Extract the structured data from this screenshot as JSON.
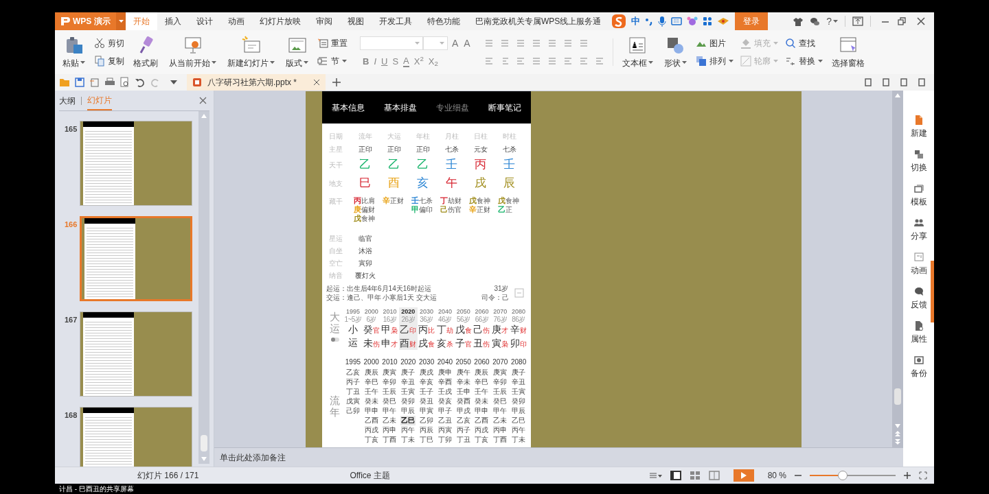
{
  "app": {
    "name": "WPS 演示"
  },
  "menu_tabs": [
    {
      "label": "开始",
      "selected": true
    },
    {
      "label": "插入",
      "selected": false
    },
    {
      "label": "设计",
      "selected": false
    },
    {
      "label": "动画",
      "selected": false
    },
    {
      "label": "幻灯片放映",
      "selected": false
    },
    {
      "label": "审阅",
      "selected": false
    },
    {
      "label": "视图",
      "selected": false
    },
    {
      "label": "开发工具",
      "selected": false
    },
    {
      "label": "特色功能",
      "selected": false
    },
    {
      "label": "巴南党政机关专属WPS线上服务通",
      "selected": false
    }
  ],
  "ime_toolbar": {
    "mode": "中"
  },
  "login_button": "登录",
  "help": "?",
  "ribbon": [
    {
      "kind": "large",
      "label": "粘贴",
      "dropdown": true
    },
    {
      "kind": "stack",
      "items": [
        {
          "label": "剪切",
          "dropdown": false,
          "disabled": false
        },
        {
          "label": "复制",
          "dropdown": false,
          "disabled": false
        }
      ]
    },
    {
      "kind": "large",
      "label": "格式刷",
      "dropdown": false
    },
    {
      "kind": "large",
      "label": "从当前开始",
      "dropdown": true
    },
    {
      "kind": "large",
      "label": "新建幻灯片",
      "dropdown": true
    },
    {
      "kind": "large",
      "label": "版式",
      "dropdown": true
    },
    {
      "kind": "stack",
      "items": [
        {
          "label": "重置",
          "dropdown": false,
          "disabled": false
        },
        {
          "label": "节",
          "dropdown": true,
          "disabled": false
        }
      ]
    },
    {
      "kind": "font",
      "size_buttons": [
        "A",
        "A"
      ],
      "format_buttons": [
        "B",
        "I",
        "U",
        "S",
        "A",
        "X$^{2}$",
        "X$_{2}$"
      ]
    },
    {
      "kind": "paragraph"
    },
    {
      "kind": "large",
      "label": "文本框",
      "dropdown": true
    },
    {
      "kind": "large",
      "label": "形状",
      "dropdown": true
    },
    {
      "kind": "stack",
      "items": [
        {
          "label": "图片",
          "dropdown": false,
          "disabled": false
        },
        {
          "label": "排列",
          "dropdown": true,
          "disabled": false
        }
      ]
    },
    {
      "kind": "stack",
      "items": [
        {
          "label": "填充",
          "dropdown": true,
          "disabled": true
        },
        {
          "label": "轮廓",
          "dropdown": true,
          "disabled": true
        }
      ]
    },
    {
      "kind": "stack",
      "items": [
        {
          "label": "查找",
          "dropdown": false,
          "disabled": false
        },
        {
          "label": "替换",
          "dropdown": true,
          "disabled": false
        }
      ]
    },
    {
      "kind": "large",
      "label": "选择窗格",
      "dropdown": false
    }
  ],
  "document_tab": {
    "title": "八字研习社第六期.pptx *"
  },
  "sidebar": {
    "tabs": [
      {
        "label": "大纲",
        "selected": false
      },
      {
        "label": "幻灯片",
        "selected": true
      }
    ],
    "slides": [
      {
        "number": "165",
        "selected": false
      },
      {
        "number": "166",
        "selected": true
      },
      {
        "number": "167",
        "selected": false
      },
      {
        "number": "168",
        "selected": false
      }
    ]
  },
  "slide": {
    "tabs": [
      {
        "label": "基本信息",
        "dimmed": false
      },
      {
        "label": "基本排盘",
        "dimmed": false
      },
      {
        "label": "专业细盘",
        "dimmed": true
      },
      {
        "label": "断事笔记",
        "dimmed": false
      }
    ],
    "columns": [
      "日期",
      "流年",
      "大运",
      "年柱",
      "月柱",
      "日柱",
      "时柱"
    ],
    "main_stars": {
      "label": "主星",
      "values": [
        "正印",
        "正印",
        "正印",
        "七杀",
        "元女",
        "七杀"
      ]
    },
    "stems": {
      "label": "天干",
      "values": [
        {
          "text": "乙",
          "color": "#16b36a"
        },
        {
          "text": "乙",
          "color": "#16b36a"
        },
        {
          "text": "乙",
          "color": "#16b36a"
        },
        {
          "text": "壬",
          "color": "#2c86d4"
        },
        {
          "text": "丙",
          "color": "#d6222e"
        },
        {
          "text": "壬",
          "color": "#2c86d4"
        }
      ]
    },
    "branches": {
      "label": "地支",
      "values": [
        {
          "text": "巳",
          "color": "#d6222e"
        },
        {
          "text": "酉",
          "color": "#e8a317"
        },
        {
          "text": "亥",
          "color": "#2c86d4"
        },
        {
          "text": "午",
          "color": "#d6222e"
        },
        {
          "text": "戌",
          "color": "#a08d1c"
        },
        {
          "text": "辰",
          "color": "#a08d1c"
        }
      ]
    },
    "hidden_stems": {
      "label": "藏干",
      "columns": [
        [
          {
            "stem": "丙",
            "color": "#d6222e",
            "god": "比肩"
          },
          {
            "stem": "庚",
            "color": "#e8a317",
            "god": "偏财"
          },
          {
            "stem": "戊",
            "color": "#a08d1c",
            "god": "食神"
          }
        ],
        [
          {
            "stem": "辛",
            "color": "#e8a317",
            "god": "正财"
          }
        ],
        [
          {
            "stem": "壬",
            "color": "#2c86d4",
            "god": "七杀"
          },
          {
            "stem": "甲",
            "color": "#16b36a",
            "god": "偏印"
          }
        ],
        [
          {
            "stem": "丁",
            "color": "#d6222e",
            "god": "劫财"
          },
          {
            "stem": "己",
            "color": "#a08d1c",
            "god": "伤官"
          }
        ],
        [
          {
            "stem": "戊",
            "color": "#a08d1c",
            "god": "食神"
          },
          {
            "stem": "辛",
            "color": "#e8a317",
            "god": "正财"
          }
        ],
        [
          {
            "stem": "戊",
            "color": "#a08d1c",
            "god": "食神"
          },
          {
            "stem": "乙",
            "color": "#16b36a",
            "god": "正"
          }
        ]
      ]
    },
    "info_rows": [
      {
        "label": "星运",
        "value": "临官"
      },
      {
        "label": "自坐",
        "value": "沐浴"
      },
      {
        "label": "空亡",
        "value": "寅卯"
      },
      {
        "label": "纳音",
        "value": "覆灯火"
      }
    ],
    "luck_lines": [
      {
        "text": "起运：出生后4年6月14天16时起运",
        "side": "31岁"
      },
      {
        "text": "交运：逢己、甲年 小寒后1天 交大运",
        "side": "司令：己"
      }
    ],
    "dayun": {
      "label": "大运",
      "columns": [
        {
          "year": "1995",
          "age": "1~5岁",
          "stem": "小",
          "branch": "运",
          "selected": false
        },
        {
          "year": "2000",
          "age": "6岁",
          "stem": "癸",
          "stem_god": "官",
          "branch": "未",
          "branch_god": "伤",
          "selected": false
        },
        {
          "year": "2010",
          "age": "16岁",
          "stem": "甲",
          "stem_god": "枭",
          "branch": "申",
          "branch_god": "才",
          "selected": false
        },
        {
          "year": "2020",
          "age": "26岁",
          "stem": "乙",
          "stem_god": "印",
          "branch": "酉",
          "branch_god": "财",
          "selected": true
        },
        {
          "year": "2030",
          "age": "36岁",
          "stem": "丙",
          "stem_god": "比",
          "branch": "戌",
          "branch_god": "食",
          "selected": false
        },
        {
          "year": "2040",
          "age": "46岁",
          "stem": "丁",
          "stem_god": "劫",
          "branch": "亥",
          "branch_god": "杀",
          "selected": false
        },
        {
          "year": "2050",
          "age": "56岁",
          "stem": "戊",
          "stem_god": "食",
          "branch": "子",
          "branch_god": "官",
          "selected": false
        },
        {
          "year": "2060",
          "age": "66岁",
          "stem": "己",
          "stem_god": "伤",
          "branch": "丑",
          "branch_god": "伤",
          "selected": false
        },
        {
          "year": "2070",
          "age": "76岁",
          "stem": "庚",
          "stem_god": "才",
          "branch": "寅",
          "branch_god": "枭",
          "selected": false
        },
        {
          "year": "2080",
          "age": "86岁",
          "stem": "辛",
          "stem_god": "财",
          "branch": "卯",
          "branch_god": "印",
          "selected": false
        }
      ]
    },
    "liunian": {
      "label": "流年",
      "columns": [
        {
          "year": "1995",
          "items": [
            {
              "text": "乙亥",
              "selected": false
            },
            {
              "text": "丙子",
              "selected": false
            },
            {
              "text": "丁丑",
              "selected": false
            },
            {
              "text": "戊寅",
              "selected": false
            },
            {
              "text": "己卯",
              "selected": false
            }
          ]
        },
        {
          "year": "2000",
          "items": [
            {
              "text": "庚辰",
              "selected": false
            },
            {
              "text": "辛巳",
              "selected": false
            },
            {
              "text": "壬午",
              "selected": false
            },
            {
              "text": "癸未",
              "selected": false
            },
            {
              "text": "甲申",
              "selected": false
            },
            {
              "text": "乙酉",
              "selected": false
            },
            {
              "text": "丙戌",
              "selected": false
            },
            {
              "text": "丁亥",
              "selected": false
            }
          ]
        },
        {
          "year": "2010",
          "items": [
            {
              "text": "庚寅",
              "selected": false
            },
            {
              "text": "辛卯",
              "selected": false
            },
            {
              "text": "壬辰",
              "selected": false
            },
            {
              "text": "癸巳",
              "selected": false
            },
            {
              "text": "甲午",
              "selected": false
            },
            {
              "text": "乙未",
              "selected": false
            },
            {
              "text": "丙申",
              "selected": false
            },
            {
              "text": "丁酉",
              "selected": false
            }
          ]
        },
        {
          "year": "2020",
          "items": [
            {
              "text": "庚子",
              "selected": false
            },
            {
              "text": "辛丑",
              "selected": false
            },
            {
              "text": "壬寅",
              "selected": false
            },
            {
              "text": "癸卯",
              "selected": false
            },
            {
              "text": "甲辰",
              "selected": false
            },
            {
              "text": "乙巳",
              "selected": true
            },
            {
              "text": "丙午",
              "selected": false
            },
            {
              "text": "丁未",
              "selected": false
            }
          ]
        },
        {
          "year": "2030",
          "items": [
            {
              "text": "庚戌",
              "selected": false
            },
            {
              "text": "辛亥",
              "selected": false
            },
            {
              "text": "壬子",
              "selected": false
            },
            {
              "text": "癸丑",
              "selected": false
            },
            {
              "text": "甲寅",
              "selected": false
            },
            {
              "text": "乙卯",
              "selected": false
            },
            {
              "text": "丙辰",
              "selected": false
            },
            {
              "text": "丁巳",
              "selected": false
            }
          ]
        },
        {
          "year": "2040",
          "items": [
            {
              "text": "庚申",
              "selected": false
            },
            {
              "text": "辛酉",
              "selected": false
            },
            {
              "text": "壬戌",
              "selected": false
            },
            {
              "text": "癸亥",
              "selected": false
            },
            {
              "text": "甲子",
              "selected": false
            },
            {
              "text": "乙丑",
              "selected": false
            },
            {
              "text": "丙寅",
              "selected": false
            },
            {
              "text": "丁卯",
              "selected": false
            }
          ]
        },
        {
          "year": "2050",
          "items": [
            {
              "text": "庚午",
              "selected": false
            },
            {
              "text": "辛未",
              "selected": false
            },
            {
              "text": "壬申",
              "selected": false
            },
            {
              "text": "癸酉",
              "selected": false
            },
            {
              "text": "甲戌",
              "selected": false
            },
            {
              "text": "乙亥",
              "selected": false
            },
            {
              "text": "丙子",
              "selected": false
            },
            {
              "text": "丁丑",
              "selected": false
            }
          ]
        },
        {
          "year": "2060",
          "items": [
            {
              "text": "庚辰",
              "selected": false
            },
            {
              "text": "辛巳",
              "selected": false
            },
            {
              "text": "壬午",
              "selected": false
            },
            {
              "text": "癸未",
              "selected": false
            },
            {
              "text": "甲申",
              "selected": false
            },
            {
              "text": "乙酉",
              "selected": false
            },
            {
              "text": "丙戌",
              "selected": false
            },
            {
              "text": "丁亥",
              "selected": false
            }
          ]
        },
        {
          "year": "2070",
          "items": [
            {
              "text": "庚寅",
              "selected": false
            },
            {
              "text": "辛卯",
              "selected": false
            },
            {
              "text": "壬辰",
              "selected": false
            },
            {
              "text": "癸巳",
              "selected": false
            },
            {
              "text": "甲午",
              "selected": false
            },
            {
              "text": "乙未",
              "selected": false
            },
            {
              "text": "丙申",
              "selected": false
            },
            {
              "text": "丁酉",
              "selected": false
            }
          ]
        },
        {
          "year": "2080",
          "items": [
            {
              "text": "庚子",
              "selected": false
            },
            {
              "text": "辛丑",
              "selected": false
            },
            {
              "text": "壬寅",
              "selected": false
            },
            {
              "text": "癸卯",
              "selected": false
            },
            {
              "text": "甲辰",
              "selected": false
            },
            {
              "text": "乙巳",
              "selected": false
            },
            {
              "text": "丙午",
              "selected": false
            },
            {
              "text": "丁未",
              "selected": false
            }
          ]
        }
      ]
    }
  },
  "notes_placeholder": "单击此处添加备注",
  "right_panel": [
    "新建",
    "切换",
    "模板",
    "分享",
    "动画",
    "反馈",
    "属性",
    "备份"
  ],
  "status_bar": {
    "slide_counter": "幻灯片 166 / 171",
    "theme": "Office 主题",
    "views": [
      {
        "selected": true
      },
      {
        "selected": false
      },
      {
        "selected": false
      }
    ],
    "zoom": {
      "reading": "80 %",
      "level": 0.38
    }
  },
  "screen_share_caption": "计昌 - 巳酉丑的共享屏幕"
}
